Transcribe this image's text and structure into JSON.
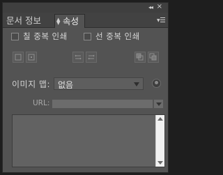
{
  "header": {
    "collapse": "◂◂",
    "close": "×"
  },
  "tabs": [
    {
      "label": "문서 정보"
    },
    {
      "label": "속성"
    }
  ],
  "options": {
    "fill_overprint": "칠 중복 인쇄",
    "stroke_overprint": "선 중복 인쇄"
  },
  "image_map": {
    "label": "이미지 맵:",
    "value": "없음"
  },
  "url": {
    "label": "URL:",
    "value": ""
  },
  "icons": [
    "collapse-icon",
    "close-icon",
    "panel-menu-icon",
    "align-left-icon",
    "align-center-icon",
    "swap-left-icon",
    "swap-right-icon",
    "arrange-back-icon",
    "arrange-front-icon",
    "globe-icon"
  ]
}
